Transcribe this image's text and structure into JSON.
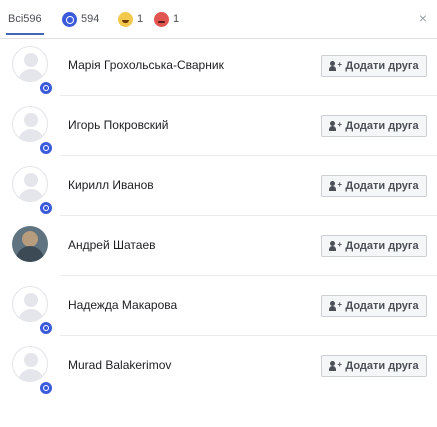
{
  "tabs": {
    "all_label": "Всі",
    "all_count": "596",
    "like_count": "594",
    "haha_count": "1",
    "angry_count": "1"
  },
  "close_symbol": "×",
  "button_label": "Додати друга",
  "people": [
    {
      "name": "Марія Грохольська-Сварник",
      "avatar": "ghost"
    },
    {
      "name": "Игорь Покровский",
      "avatar": "ghost"
    },
    {
      "name": "Кирилл Иванов",
      "avatar": "ghost"
    },
    {
      "name": "Андрей Шатаев",
      "avatar": "photo"
    },
    {
      "name": "Надежда Макарова",
      "avatar": "ghost"
    },
    {
      "name": "Murad Balakerimov",
      "avatar": "ghost"
    }
  ],
  "colors": {
    "accent": "#4267b2",
    "like": "#3b5bdb",
    "haha": "#f2c94c",
    "angry": "#e0554f"
  }
}
